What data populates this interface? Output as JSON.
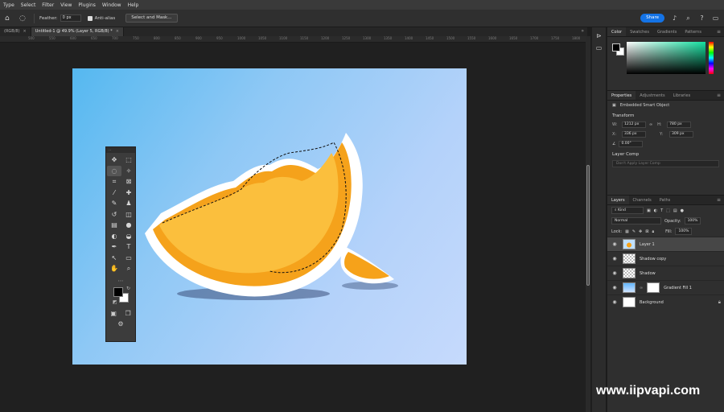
{
  "menubar": {
    "items": [
      "Type",
      "Select",
      "Filter",
      "View",
      "Plugins",
      "Window",
      "Help"
    ]
  },
  "options": {
    "feather_label": "Feather:",
    "feather_value": "0 px",
    "antialias_label": "Anti-alias",
    "select_mask_label": "Select and Mask...",
    "share_label": "Share"
  },
  "tabs": [
    {
      "label": "(RGB/8)"
    },
    {
      "label": "Untitled-1 @ 49.9% (Layer 5, RGB/8) *"
    }
  ],
  "ruler": {
    "ticks": [
      "500",
      "550",
      "600",
      "650",
      "700",
      "750",
      "800",
      "850",
      "900",
      "950",
      "1000",
      "1050",
      "1100",
      "1150",
      "1200",
      "1250",
      "1300",
      "1350",
      "1400",
      "1450",
      "1500",
      "1550",
      "1600",
      "1650",
      "1700",
      "1750",
      "1800"
    ]
  },
  "color_panel": {
    "tabs": [
      "Color",
      "Swatches",
      "Gradients",
      "Patterns"
    ],
    "fg": "#000000",
    "bg": "#ffffff"
  },
  "properties": {
    "tabs": [
      "Properties",
      "Adjustments",
      "Libraries"
    ],
    "object_type": "Embedded Smart Object",
    "transform_label": "Transform",
    "w_label": "W:",
    "w_value": "1212 px",
    "h_label": "H:",
    "h_value": "780 px",
    "x_label": "X:",
    "x_value": "336 px",
    "y_label": "Y:",
    "y_value": "309 px",
    "angle_value": "0.00°",
    "layer_comp_label": "Layer Comp",
    "layer_comp_placeholder": "Don't Apply Layer Comp"
  },
  "layers": {
    "tabs": [
      "Layers",
      "Channels",
      "Paths"
    ],
    "filter_kind": "Kind",
    "blend_mode": "Normal",
    "opacity_label": "Opacity:",
    "opacity_value": "100%",
    "lock_label": "Lock:",
    "fill_label": "Fill:",
    "fill_value": "100%",
    "items": [
      {
        "name": "Layer 1",
        "thumb": "orange",
        "selected": true
      },
      {
        "name": "Shadow copy",
        "thumb": "check",
        "selected": false
      },
      {
        "name": "Shadow",
        "thumb": "check",
        "selected": false
      },
      {
        "name": "Gradient Fill 1",
        "thumb": "grad",
        "selected": false
      },
      {
        "name": "Background",
        "thumb": "white",
        "selected": false
      }
    ]
  },
  "watermark": "www.iipvapi.com"
}
